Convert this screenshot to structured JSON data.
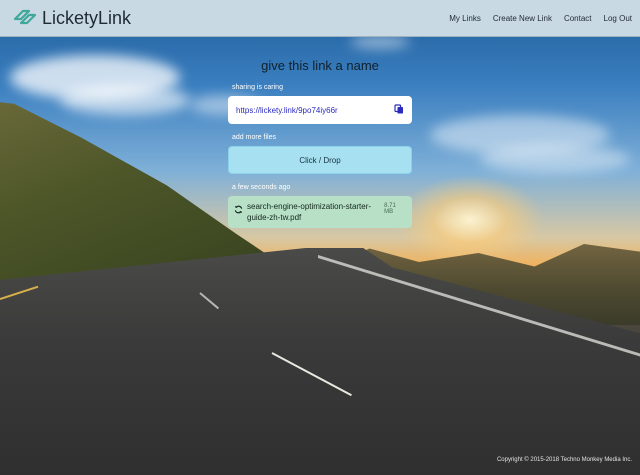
{
  "header": {
    "brand": "LicketyLink",
    "nav": [
      "My Links",
      "Create New Link",
      "Contact",
      "Log Out"
    ]
  },
  "main": {
    "title": "give this link a name",
    "share_label": "sharing is caring",
    "link": "https://lickety.link/9po74iy66r",
    "add_files_label": "add more files",
    "drop_label": "Click / Drop",
    "upload_time": "a few seconds ago",
    "file": {
      "name": "search-engine-optimization-starter-guide-zh-tw.pdf",
      "size": "8.71 MB"
    }
  },
  "footer": {
    "copyright": "Copyright © 2015-2018 Techno Monkey Media Inc."
  },
  "colors": {
    "header_bg": "#c9d9e3",
    "brand_accent": "#3fa89a",
    "drop_bg": "#a7e1f1",
    "file_bg": "#b7e0c6",
    "link_color": "#2b2bbf"
  },
  "icons": {
    "logo": "link-logo-icon",
    "copy": "copy-icon",
    "sync": "sync-icon"
  }
}
